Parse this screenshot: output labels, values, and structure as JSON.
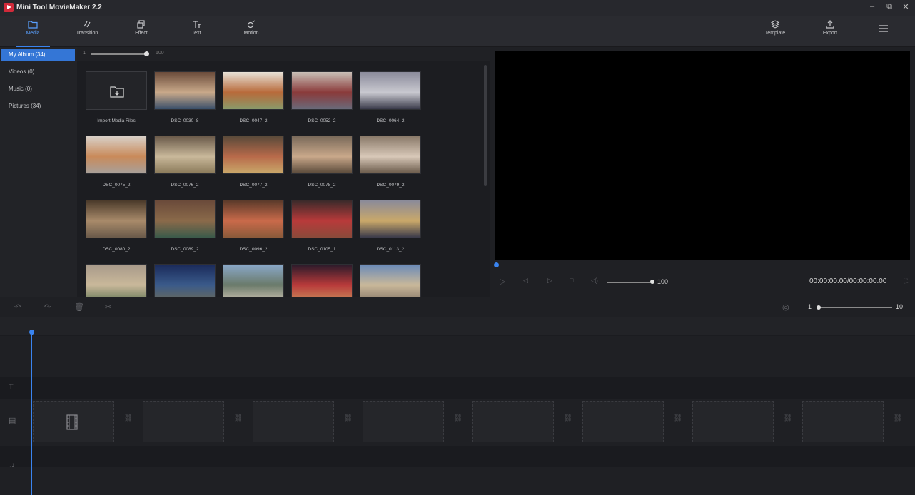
{
  "app": {
    "title": "Mini Tool MovieMaker 2.2"
  },
  "window_controls": {
    "minimize": "–",
    "restore": "⧉",
    "close": "✕"
  },
  "toolbar": {
    "items": [
      {
        "label": "Media",
        "icon": "folder-icon",
        "active": true
      },
      {
        "label": "Transition",
        "icon": "transition-icon",
        "active": false
      },
      {
        "label": "Effect",
        "icon": "effect-icon",
        "active": false
      },
      {
        "label": "Text",
        "icon": "text-icon",
        "active": false
      },
      {
        "label": "Motion",
        "icon": "motion-icon",
        "active": false
      }
    ],
    "template_label": "Template",
    "export_label": "Export",
    "menu_icon": "hamburger-icon"
  },
  "sidebar": {
    "items": [
      {
        "label": "My Album  (34)",
        "active": true
      },
      {
        "label": "Videos  (0)",
        "active": false
      },
      {
        "label": "Music  (0)",
        "active": false
      },
      {
        "label": "Pictures  (34)",
        "active": false
      }
    ]
  },
  "media": {
    "zoom_min": "1",
    "zoom_max": "100",
    "import_label": "Import Media Files",
    "thumbnails": [
      {
        "label": "DSC_0030_8",
        "colors": [
          "#6a4b3a",
          "#c9a98a",
          "#3a4f6a"
        ]
      },
      {
        "label": "DSC_0047_2",
        "colors": [
          "#e8e2d8",
          "#b86a3a",
          "#8a9a6a"
        ]
      },
      {
        "label": "DSC_0052_2",
        "colors": [
          "#c9c1b8",
          "#8a3a3a",
          "#6a6a7a"
        ]
      },
      {
        "label": "DSC_0064_2",
        "colors": [
          "#8a8a9a",
          "#c9c9d0",
          "#3a3a4a"
        ]
      },
      {
        "label": "DSC_0075_2",
        "colors": [
          "#d8d0c8",
          "#c98a5a",
          "#a8a09a"
        ]
      },
      {
        "label": "DSC_0076_2",
        "colors": [
          "#6a5a4a",
          "#c9b89a",
          "#8a7a5a"
        ]
      },
      {
        "label": "DSC_0077_2",
        "colors": [
          "#5a4a3a",
          "#b86a4a",
          "#c9a86a"
        ]
      },
      {
        "label": "DSC_0078_2",
        "colors": [
          "#7a6a5a",
          "#c9a88a",
          "#5a4a3a"
        ]
      },
      {
        "label": "DSC_0079_2",
        "colors": [
          "#8a7a6a",
          "#d8c8b8",
          "#6a5a4a"
        ]
      },
      {
        "label": "DSC_0080_2",
        "colors": [
          "#4a3a2a",
          "#a88a6a",
          "#6a5a4a"
        ]
      },
      {
        "label": "DSC_0089_2",
        "colors": [
          "#6a4a3a",
          "#8a6a4a",
          "#3a5a4a"
        ]
      },
      {
        "label": "DSC_0096_2",
        "colors": [
          "#5a3a2a",
          "#c96a4a",
          "#8a5a3a"
        ]
      },
      {
        "label": "DSC_0105_1",
        "colors": [
          "#3a2a2a",
          "#b83a3a",
          "#8a4a3a"
        ]
      },
      {
        "label": "DSC_0113_2",
        "colors": [
          "#8a8a9a",
          "#c9a86a",
          "#3a3a4a"
        ]
      },
      {
        "label": "",
        "colors": [
          "#a89a8a",
          "#c9b89a",
          "#6a7a5a"
        ]
      },
      {
        "label": "",
        "colors": [
          "#1a2a5a",
          "#3a5a8a",
          "#6a6a5a"
        ]
      },
      {
        "label": "",
        "colors": [
          "#8aa8c9",
          "#6a7a6a",
          "#c9c0b0"
        ]
      },
      {
        "label": "",
        "colors": [
          "#2a1a2a",
          "#b83a3a",
          "#c98a5a"
        ]
      },
      {
        "label": "",
        "colors": [
          "#6a8ab8",
          "#c9b89a",
          "#8a7a6a"
        ]
      }
    ]
  },
  "preview": {
    "volume_value": "100",
    "volume_level": 1.0,
    "progress": 0.0,
    "timecode": "00:00:00.00/00:00:00.00"
  },
  "timeline": {
    "zoom_min": "1",
    "zoom_max": "10"
  }
}
